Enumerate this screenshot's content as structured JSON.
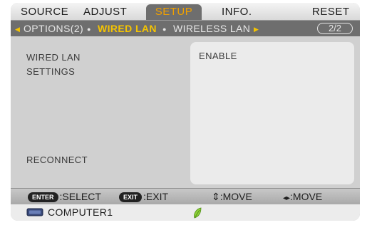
{
  "tabs": [
    {
      "label": "SOURCE"
    },
    {
      "label": "ADJUST"
    },
    {
      "label": "SETUP",
      "active": true
    },
    {
      "label": "INFO."
    },
    {
      "label": "RESET"
    }
  ],
  "subtabs": {
    "left_arrow": "◀",
    "items": [
      {
        "label": "OPTIONS(2)"
      },
      {
        "label": "WIRED LAN",
        "active": true
      },
      {
        "label": "WIRELESS LAN"
      }
    ],
    "dot": "●",
    "right_arrow": "▶",
    "page_indicator": "2/2"
  },
  "content": {
    "labels": [
      "WIRED LAN",
      "SETTINGS",
      "RECONNECT"
    ],
    "value": "ENABLE"
  },
  "helpbar": {
    "enter_key": "ENTER",
    "enter_label": ":SELECT",
    "exit_key": "EXIT",
    "exit_label": ":EXIT",
    "updown_label": ":MOVE",
    "leftright_label": ":MOVE",
    "updown_icon": "⇕",
    "leftright_icon": "◂▸"
  },
  "statusbar": {
    "input_source": "COMPUTER1",
    "source_icon": "computer-icon",
    "eco_icon": "leaf-icon"
  },
  "colors": {
    "active_tab_text": "#f0a000",
    "active_subtab": "#f5c400",
    "tab_bg": "#6e6e6e"
  }
}
